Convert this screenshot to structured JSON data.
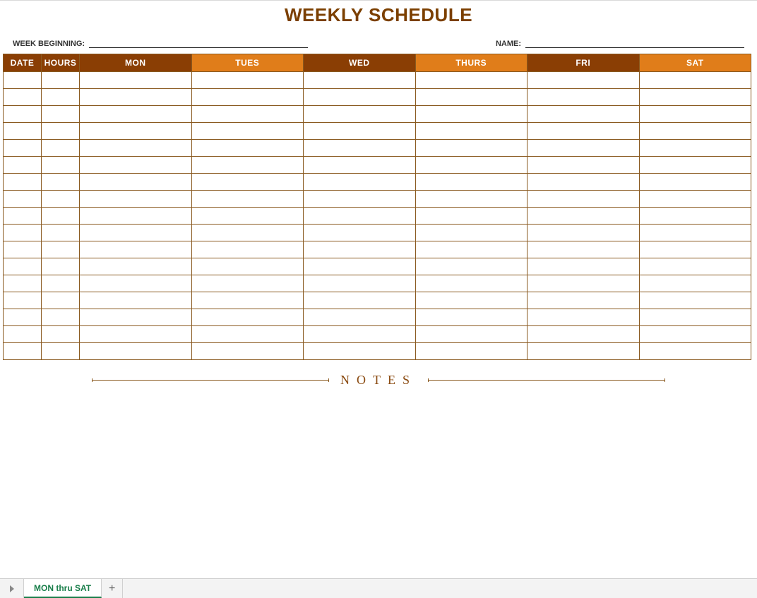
{
  "title": "WEEKLY SCHEDULE",
  "meta": {
    "week_label": "WEEK BEGINNING:",
    "week_value": "",
    "name_label": "NAME:",
    "name_value": ""
  },
  "headers": {
    "date": "DATE",
    "hours": "HOURS",
    "days": [
      "MON",
      "TUES",
      "WED",
      "THURS",
      "FRI",
      "SAT"
    ]
  },
  "row_count": 17,
  "notes_label": "NOTES",
  "tabs": {
    "active": "MON thru SAT"
  }
}
